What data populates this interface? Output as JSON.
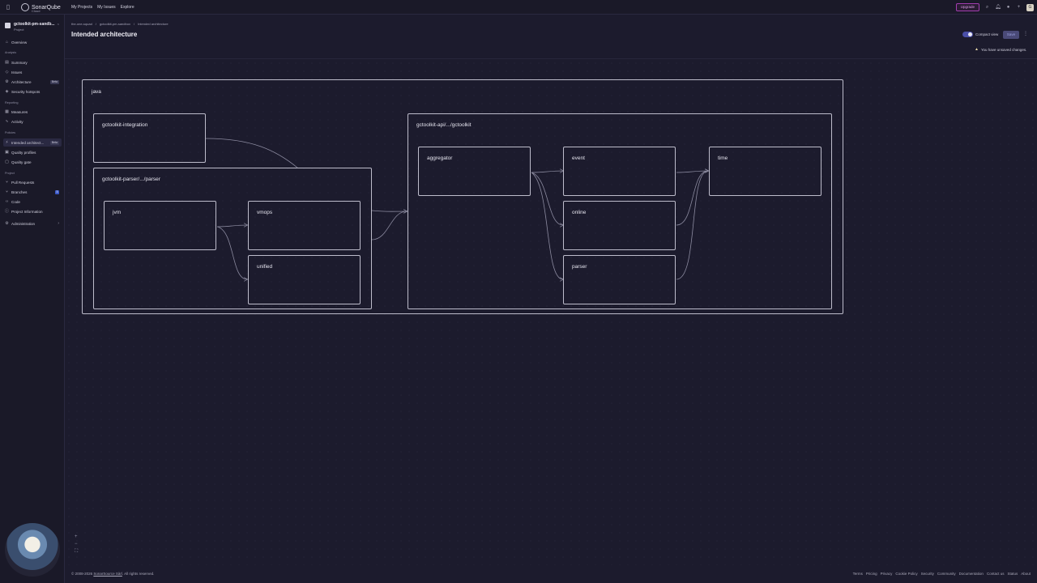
{
  "topbar": {
    "logo_text": "SonarQube",
    "logo_sub": "Cloud",
    "nav": [
      "My Projects",
      "My Issues",
      "Explore"
    ],
    "upgrade_label": "Upgrade",
    "avatar_initial": "G"
  },
  "sidebar": {
    "project_name": "gctoolkit-pm-sandb...",
    "project_sub": "Project",
    "overview": "Overview",
    "section_analysis": "Analysis",
    "summary": "Summary",
    "issues": "Issues",
    "architecture": "Architecture",
    "architecture_badge": "Beta",
    "security_hotspots": "Security hotspots",
    "section_reporting": "Reporting",
    "measures": "Measures",
    "activity": "Activity",
    "section_policies": "Policies",
    "intended_architecture": "Intended architect...",
    "intended_badge": "Beta",
    "quality_profiles": "Quality profiles",
    "quality_gate": "Quality gate",
    "section_project": "Project",
    "pull_requests": "Pull Requests",
    "branches": "Branches",
    "branches_count": "3",
    "code": "Code",
    "project_information": "Project Information",
    "administration": "Administration"
  },
  "breadcrumb": [
    "the-one-squad",
    "gctoolkit-pm-sandbox",
    "Intended architecture"
  ],
  "page_title": "Intended architecture",
  "compact_view_label": "Compact view",
  "save_label": "Save",
  "unsaved_message": "You have unsaved changes.",
  "diagram": {
    "java": "java",
    "integration": "gctoolkit-integration",
    "parser_group": "gctoolkit-parser/.../parser",
    "jvm": "jvm",
    "vmops": "vmops",
    "unified": "unified",
    "api_group": "gctoolkit-api/.../gctoolkit",
    "aggregator": "aggregator",
    "event": "event",
    "online": "online",
    "parser": "parser",
    "time": "time"
  },
  "zoom": {
    "in": "+",
    "out": "−",
    "fit": "⛶"
  },
  "footer": {
    "copy_prefix": "© 2008-2026",
    "copy_company": "SonarSource Sàrl",
    "copy_suffix": ". All rights reserved.",
    "links": [
      "Terms",
      "Pricing",
      "Privacy",
      "Cookie Policy",
      "Security",
      "Community",
      "Documentation",
      "Contact us",
      "Status",
      "About"
    ]
  }
}
